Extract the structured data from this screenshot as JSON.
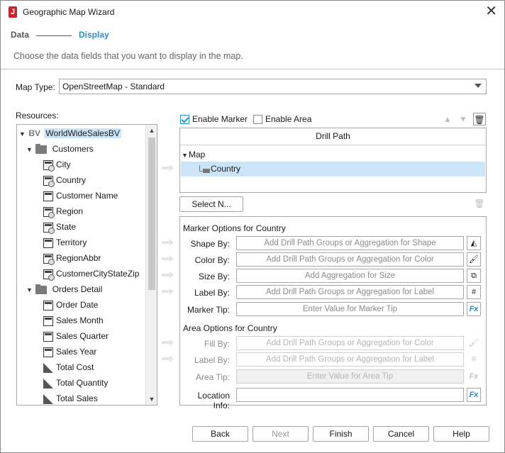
{
  "window": {
    "title": "Geographic Map Wizard",
    "close_glyph": "✕"
  },
  "steps": {
    "step1": "Data",
    "step2": "Display"
  },
  "instruction": "Choose the data fields that you want to display in the map.",
  "map_type": {
    "label": "Map Type:",
    "value": "OpenStreetMap - Standard"
  },
  "resources": {
    "label": "Resources:",
    "root": {
      "badge": "BV",
      "label": "WorldWideSalesBV"
    },
    "customers_folder": "Customers",
    "customers_fields": [
      "City",
      "Country",
      "Customer Name",
      "Region",
      "State",
      "Territory",
      "RegionAbbr",
      "CustomerCityStateZip"
    ],
    "orders_folder": "Orders Detail",
    "orders_fields": [
      "Order Date",
      "Sales Month",
      "Sales Quarter",
      "Sales Year"
    ],
    "measures": [
      "Total Cost",
      "Total Quantity",
      "Total Sales"
    ]
  },
  "enable_marker": {
    "label": "Enable Marker",
    "checked": true
  },
  "enable_area": {
    "label": "Enable Area",
    "checked": false
  },
  "drill_path": {
    "header": "Drill Path",
    "root": "Map",
    "item": "Country",
    "select_button": "Select N..."
  },
  "marker_options": {
    "title": "Marker Options for Country",
    "shape_label": "Shape By:",
    "shape_placeholder": "Add Drill Path Groups or Aggregation for Shape",
    "color_label": "Color By:",
    "color_placeholder": "Add Drill Path Groups or Aggregation for Color",
    "size_label": "Size By:",
    "size_placeholder": "Add Aggregation for Size",
    "label_label": "Label By:",
    "label_placeholder": "Add Drill Path Groups or Aggregation for Label",
    "tip_label": "Marker Tip:",
    "tip_placeholder": "Enter Value for Marker Tip"
  },
  "area_options": {
    "title": "Area Options for Country",
    "fill_label": "Fill By:",
    "fill_placeholder": "Add Drill Path Groups or Aggregation for Color",
    "label_label": "Label By:",
    "label_placeholder": "Add Drill Path Groups or Aggregation for Label",
    "tip_label": "Area Tip:",
    "tip_placeholder": "Enter Value for Area Tip"
  },
  "location_info": {
    "label": "Location Info:",
    "value": ""
  },
  "footer": {
    "back": "Back",
    "next": "Next",
    "finish": "Finish",
    "cancel": "Cancel",
    "help": "Help"
  },
  "icons": {
    "move_up": "▲",
    "move_down": "▼",
    "delete": "🗑",
    "fx": "Fx",
    "hash": "#",
    "shape": "◭",
    "color": "🖌",
    "size": "⧉",
    "expand": "▼",
    "scroll_up": "▲",
    "scroll_down": "▼"
  },
  "colors": {
    "accent": "#2a8fc8",
    "selection": "#cce4f7",
    "brand": "#c6262e"
  }
}
